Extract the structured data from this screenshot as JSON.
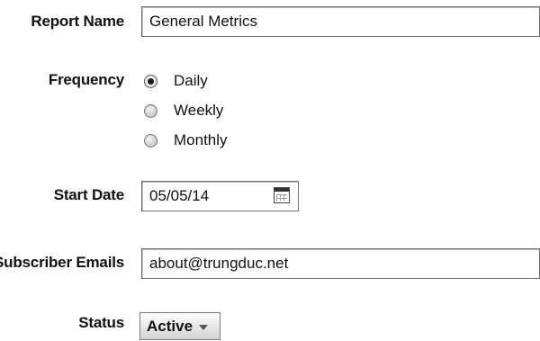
{
  "form": {
    "report_name": {
      "label": "Report Name",
      "value": "General Metrics"
    },
    "frequency": {
      "label": "Frequency",
      "options": [
        {
          "label": "Daily",
          "checked": true
        },
        {
          "label": "Weekly",
          "checked": false
        },
        {
          "label": "Monthly",
          "checked": false
        }
      ]
    },
    "start_date": {
      "label": "Start Date",
      "value": "05/05/14",
      "icon": "calendar-icon"
    },
    "subscriber_emails": {
      "label": "Subscriber Emails",
      "value": "about@trungduc.net"
    },
    "status": {
      "label": "Status",
      "value": "Active",
      "icon": "chevron-down-icon"
    }
  }
}
